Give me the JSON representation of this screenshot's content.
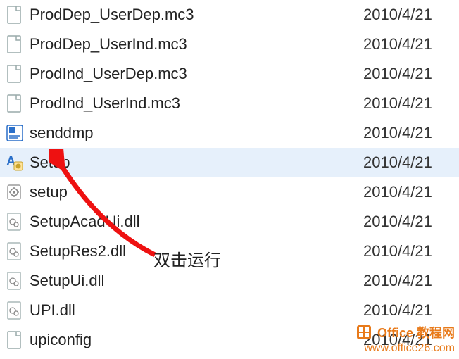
{
  "files": [
    {
      "name": "ProdDep_UserDep.mc3",
      "date": "2010/4/21",
      "icon": "file"
    },
    {
      "name": "ProdDep_UserInd.mc3",
      "date": "2010/4/21",
      "icon": "file"
    },
    {
      "name": "ProdInd_UserDep.mc3",
      "date": "2010/4/21",
      "icon": "file"
    },
    {
      "name": "ProdInd_UserInd.mc3",
      "date": "2010/4/21",
      "icon": "file"
    },
    {
      "name": "senddmp",
      "date": "2010/4/21",
      "icon": "app-doc"
    },
    {
      "name": "Setup",
      "date": "2010/4/21",
      "icon": "installer",
      "selected": true
    },
    {
      "name": "setup",
      "date": "2010/4/21",
      "icon": "config"
    },
    {
      "name": "SetupAcadUi.dll",
      "date": "2010/4/21",
      "icon": "dll"
    },
    {
      "name": "SetupRes2.dll",
      "date": "2010/4/21",
      "icon": "dll"
    },
    {
      "name": "SetupUi.dll",
      "date": "2010/4/21",
      "icon": "dll"
    },
    {
      "name": "UPI.dll",
      "date": "2010/4/21",
      "icon": "dll"
    },
    {
      "name": "upiconfig",
      "date": "2010/4/21",
      "icon": "file"
    }
  ],
  "annotation": {
    "text": "双击运行"
  },
  "watermark": {
    "top": "Office 教程网",
    "bottom": "www.office26.com"
  }
}
